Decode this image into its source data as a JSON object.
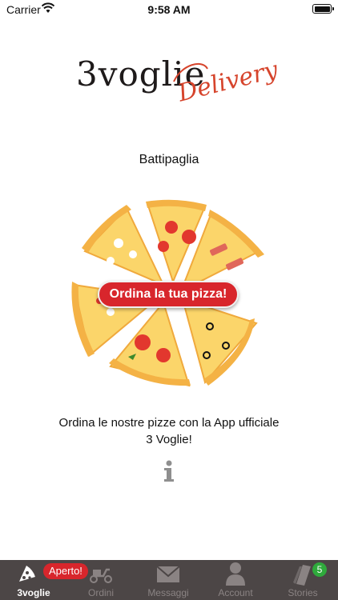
{
  "status_bar": {
    "carrier": "Carrier",
    "time": "9:58 AM"
  },
  "logo": {
    "main_text": "3voglie",
    "script_text": "Delivery"
  },
  "location": {
    "city": "Battipaglia"
  },
  "hero": {
    "order_button_label": "Ordina la tua pizza!"
  },
  "description": {
    "line1": "Ordina le nostre pizze con la App ufficiale",
    "line2": "3 Voglie!"
  },
  "tab_bar": {
    "open_badge": "Aperto!",
    "stories_count": "5",
    "tabs": [
      {
        "label": "3voglie",
        "icon": "pizza-slice-icon",
        "active": true
      },
      {
        "label": "Ordini",
        "icon": "scooter-icon",
        "active": false
      },
      {
        "label": "Messaggi",
        "icon": "envelope-icon",
        "active": false
      },
      {
        "label": "Account",
        "icon": "user-icon",
        "active": false
      },
      {
        "label": "Stories",
        "icon": "stories-icon",
        "active": false
      }
    ]
  },
  "colors": {
    "accent_red": "#d8262c",
    "tabbar_bg": "#4c4646",
    "badge_green": "#2faa3c"
  }
}
